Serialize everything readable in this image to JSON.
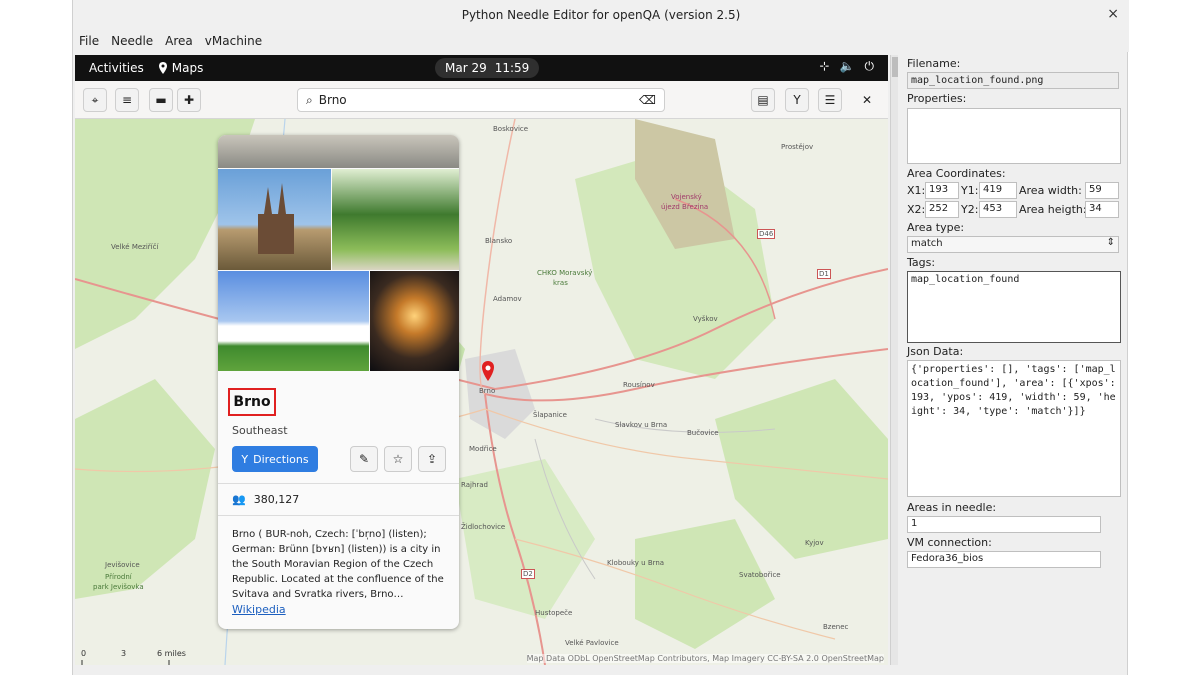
{
  "window": {
    "title": "Python Needle Editor for openQA (version 2.5)",
    "close": "×"
  },
  "menu": [
    "File",
    "Needle",
    "Area",
    "vMachine"
  ],
  "gnome": {
    "activities": "Activities",
    "app": "Maps",
    "date": "Mar 29",
    "time": "11:59"
  },
  "maps": {
    "search_value": "Brno",
    "place": {
      "name": "Brno",
      "region": "Southeast",
      "directions": "Directions",
      "population": "380,127",
      "description": "Brno ( BUR-noh, Czech: [ˈbr̩no] (listen); German: Brünn [bʏʁn] (listen)) is a city in the South Moravian Region of the Czech Republic. Located at the confluence of the Svitava and Svratka rivers, Brno…",
      "wiki": "Wikipedia"
    },
    "labels": {
      "boskovice": "Boskovice",
      "prostejov": "Prostějov",
      "vojensky": "Vojenský",
      "ujezd": "újezd Březina",
      "velka_mezirici": "Velké Meziříčí",
      "blansko": "Blansko",
      "chko": "CHKO Moravský",
      "kras": "kras",
      "adamov": "Adamov",
      "vyskov": "Vyškov",
      "brno": "Brno",
      "rousinov": "Rousínov",
      "slapanice": "Šlapanice",
      "slavkov": "Slavkov u Brna",
      "bucovice": "Bučovice",
      "modrice": "Modřice",
      "rajhrad": "Rajhrad",
      "zidlochovice": "Židlochovice",
      "klobouky": "Klobouky u Brna",
      "hustopece": "Hustopeče",
      "velke_pavlovice": "Velké Pavlovice",
      "svatobořice": "Svatobořice",
      "bzenec": "Bzenec",
      "kyjov": "Kyjov",
      "jevisovice": "Jevišovice",
      "prirodni": "Přírodní",
      "park": "park Jevišovka",
      "d46": "D46",
      "d1": "D1",
      "d2": "D2"
    },
    "scale": {
      "zero": "0",
      "three": "3",
      "six": "6 miles"
    },
    "attribution": "Map Data ODbL OpenStreetMap Contributors, Map Imagery CC-BY-SA 2.0 OpenStreetMap"
  },
  "panel": {
    "filename_label": "Filename:",
    "filename": "map_location_found.png",
    "properties_label": "Properties:",
    "coords_label": "Area Coordinates:",
    "x1_label": "X1:",
    "x1": "193",
    "y1_label": "Y1:",
    "y1": "419",
    "x2_label": "X2:",
    "x2": "252",
    "y2_label": "Y2:",
    "y2": "453",
    "width_label": "Area width:",
    "width": "59",
    "height_label": "Area heigth:",
    "height": "34",
    "type_label": "Area type:",
    "type": "match",
    "tags_label": "Tags:",
    "tags": "map_location_found",
    "json_label": "Json Data:",
    "json": "{'properties': [], 'tags': ['map_location_found'], 'area': [{'xpos': 193, 'ypos': 419, 'width': 59, 'height': 34, 'type': 'match'}]}",
    "areas_label": "Areas in needle:",
    "areas": "1",
    "vm_label": "VM connection:",
    "vm": "Fedora36_bios"
  },
  "colors": {
    "accent": "#2f7de1",
    "marker": "#e02020",
    "highlight": "#e02020"
  }
}
